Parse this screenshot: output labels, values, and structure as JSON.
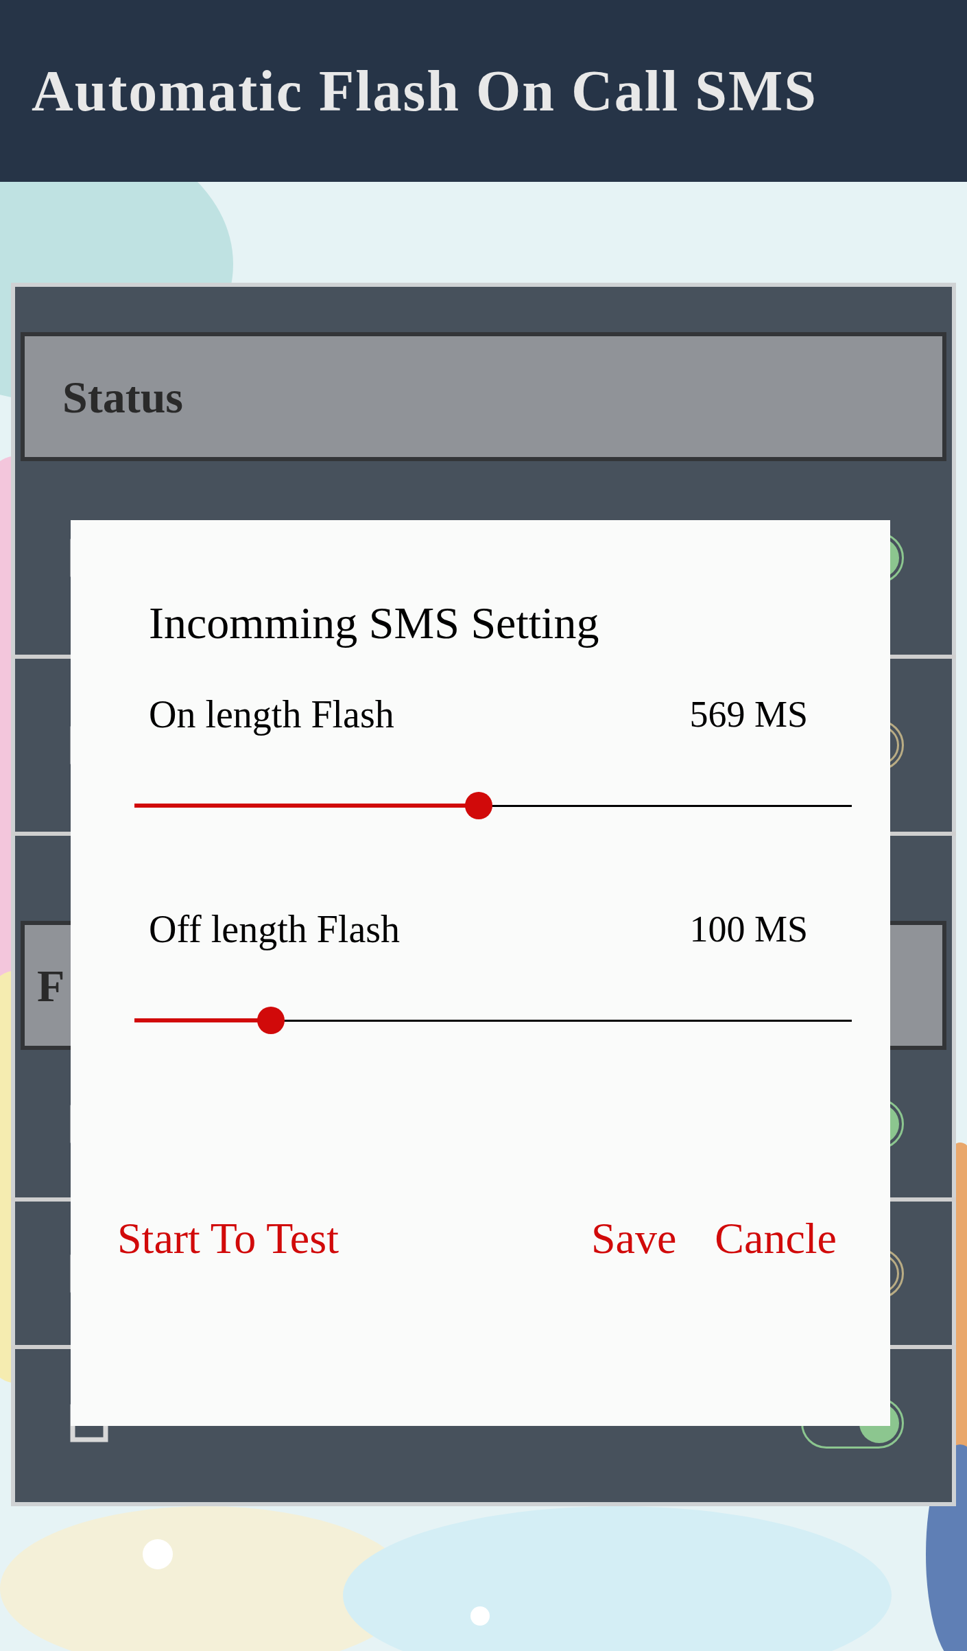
{
  "app_bar": {
    "title": "Automatic Flash On Call SMS"
  },
  "sections": [
    {
      "title": "Status",
      "rows": [
        {
          "on": true
        },
        {
          "on": false
        }
      ]
    },
    {
      "title": "F",
      "rows": [
        {
          "on": true
        },
        {
          "on": false
        },
        {
          "on": true
        }
      ]
    }
  ],
  "dialog": {
    "title": "Incomming SMS Setting",
    "sliders": [
      {
        "label": "On length Flash",
        "reading": "569 MS",
        "level": 0.48
      },
      {
        "label": "Off length Flash",
        "reading": "100 MS",
        "level": 0.19
      }
    ],
    "buttons": [
      "Start To Test",
      "Save",
      "Cancle"
    ]
  }
}
